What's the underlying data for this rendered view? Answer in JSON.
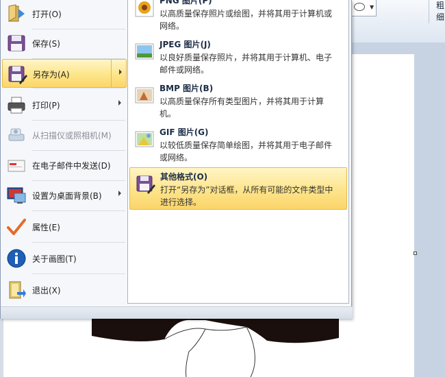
{
  "ribbon": {
    "size_label": "粗细"
  },
  "menu": {
    "items": [
      {
        "label": "打开(O)",
        "icon": "folder-open-icon"
      },
      {
        "label": "保存(S)",
        "icon": "floppy-disk-icon"
      },
      {
        "label": "另存为(A)",
        "icon": "save-as-icon"
      },
      {
        "label": "打印(P)",
        "icon": "printer-icon"
      },
      {
        "label": "从扫描仪或照相机(M)",
        "icon": "scanner-icon"
      },
      {
        "label": "在电子邮件中发送(D)",
        "icon": "email-icon"
      },
      {
        "label": "设置为桌面背景(B)",
        "icon": "desktop-background-icon"
      },
      {
        "label": "属性(E)",
        "icon": "checkmark-icon"
      },
      {
        "label": "关于画图(T)",
        "icon": "info-icon"
      },
      {
        "label": "退出(X)",
        "icon": "exit-icon"
      }
    ]
  },
  "submenu": {
    "items": [
      {
        "title": "PNG 图片(P)",
        "desc": "以高质量保存照片或绘图，并将其用于计算机或网络。",
        "icon": "png-image-icon"
      },
      {
        "title": "JPEG 图片(J)",
        "desc": "以良好质量保存照片，并将其用于计算机、电子邮件或网络。",
        "icon": "jpeg-image-icon"
      },
      {
        "title": "BMP 图片(B)",
        "desc": "以高质量保存所有类型图片，并将其用于计算机。",
        "icon": "bmp-image-icon"
      },
      {
        "title": "GIF 图片(G)",
        "desc": "以较低质量保存简单绘图，并将其用于电子邮件或网络。",
        "icon": "gif-image-icon"
      },
      {
        "title": "其他格式(O)",
        "desc": "打开“另存为”对话框，从所有可能的文件类型中进行选择。",
        "icon": "other-formats-icon"
      }
    ]
  },
  "colors": {
    "hover_top": "#fff6c8",
    "hover_bottom": "#fcd66a",
    "hover_border": "#e5b94e"
  }
}
